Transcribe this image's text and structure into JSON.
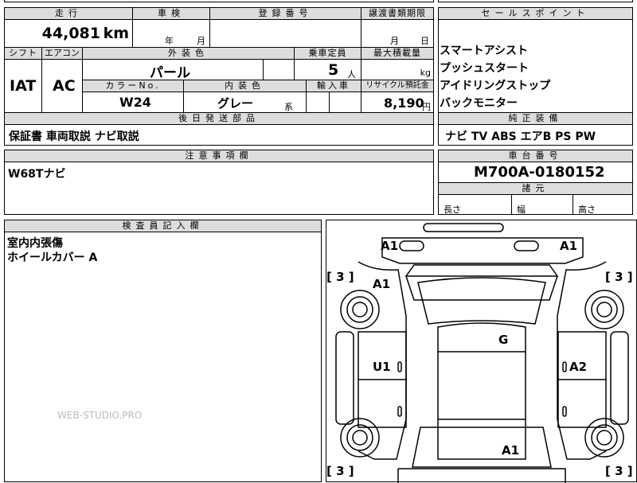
{
  "top": {
    "headers": {
      "mileage": "走行",
      "inspection": "車検",
      "registration": "登録番号",
      "transfer_deadline": "譲渡書類期限",
      "shift": "シフト",
      "aircon": "エアコン",
      "exterior_color": "外装色",
      "capacity": "乗車定員",
      "max_load": "最大積載量",
      "color_no": "カラーNo.",
      "interior_color": "内装色",
      "import": "輸入車",
      "recycle_fee": "リサイクル預託金",
      "later_parts": "後日発送部品",
      "notes": "注意事項欄",
      "inspector": "検査員記入欄"
    },
    "mileage_value": "44,081",
    "mileage_unit": "km",
    "year_unit": "年",
    "month_unit": "月",
    "transfer_month_unit": "月",
    "transfer_day_unit": "日",
    "shift_value": "IAT",
    "aircon_value": "AC",
    "exterior_color_value": "パール",
    "capacity_value": "5",
    "capacity_unit": "人",
    "max_load_unit": "kg",
    "color_no_value": "W24",
    "interior_color_value": "グレー",
    "interior_suffix": "系",
    "recycle_value": "8,190",
    "recycle_unit": "円",
    "later_parts_value": "保証書 車両取説 ナビ取説",
    "notes_value": "W68Tナビ",
    "inspector_lines": [
      "室内内張傷",
      "ホイールカバー A"
    ]
  },
  "right": {
    "sales_header": "セールスポイント",
    "sales_points": [
      "スマートアシスト",
      "プッシュスタート",
      "アイドリングストップ",
      "バックモニター"
    ],
    "genuine_header": "純正装備",
    "genuine_value": "ナビ TV ABS エアB PS PW",
    "chassis_header": "車台番号",
    "chassis_value": "M700A-0180152",
    "dims_header": "諸元",
    "dims_labels": [
      "長さ",
      "幅",
      "高さ"
    ]
  },
  "diagram": {
    "marks": {
      "front_left": "A1",
      "front_right": "A1",
      "hood_left": "A1",
      "roof": "G",
      "left_door": "U1",
      "right_door": "A2",
      "rear": "A1"
    },
    "brackets": {
      "fl": "[ 3 ]",
      "fr": "[ 3 ]",
      "rl": "[ 3 ]",
      "rr": "[ 3 ]"
    }
  },
  "watermark": "WEB-STUDIO.PRO"
}
